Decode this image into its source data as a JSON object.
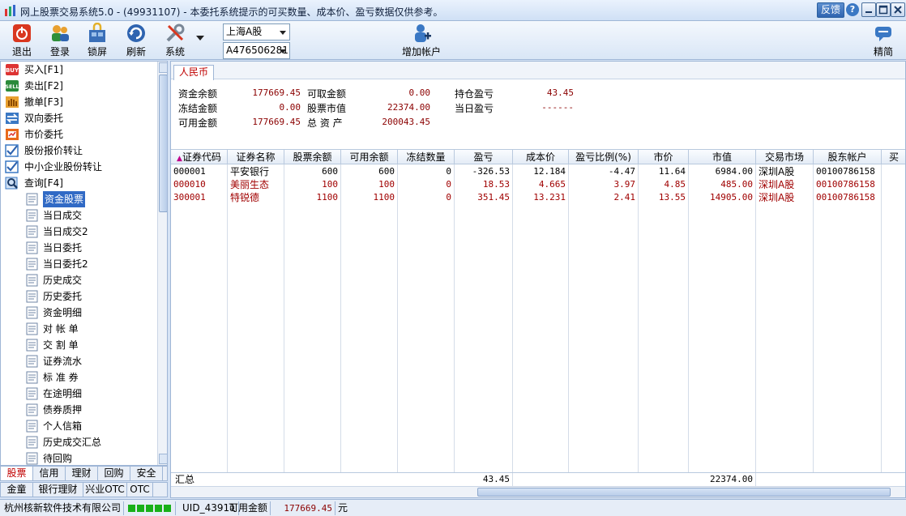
{
  "window": {
    "title": "网上股票交易系统5.0 - (49931107) - 本委托系统提示的可买数量、成本价、盈亏数据仅供参考。",
    "feedback": "反馈",
    "help": "?"
  },
  "toolbar": {
    "exit": "退出",
    "login": "登录",
    "lock": "锁屏",
    "refresh": "刷新",
    "system": "系统",
    "market_select": "上海A股",
    "account_select": "A476506281",
    "add_account": "增加帐户",
    "simple": "精简"
  },
  "tree": [
    {
      "label": "买入[F1]",
      "icon": "buy-icon"
    },
    {
      "label": "卖出[F2]",
      "icon": "sell-icon"
    },
    {
      "label": "撤单[F3]",
      "icon": "cancel-hand-icon"
    },
    {
      "label": "双向委托",
      "icon": "bidirectional-icon"
    },
    {
      "label": "市价委托",
      "icon": "market-order-icon"
    },
    {
      "label": "股份报价转让",
      "icon": "checkbox-icon"
    },
    {
      "label": "中小企业股份转让",
      "icon": "checkbox-icon"
    },
    {
      "label": "查询[F4]",
      "icon": "query-icon"
    },
    {
      "label": "资金股票",
      "icon": "document-icon",
      "selected": true
    },
    {
      "label": "当日成交",
      "icon": "document-icon"
    },
    {
      "label": "当日成交2",
      "icon": "document-icon"
    },
    {
      "label": "当日委托",
      "icon": "document-icon"
    },
    {
      "label": "当日委托2",
      "icon": "document-icon"
    },
    {
      "label": "历史成交",
      "icon": "document-icon"
    },
    {
      "label": "历史委托",
      "icon": "document-icon"
    },
    {
      "label": "资金明细",
      "icon": "document-icon"
    },
    {
      "label": "对 帐 单",
      "icon": "document-icon"
    },
    {
      "label": "交 割 单",
      "icon": "document-icon"
    },
    {
      "label": "证券流水",
      "icon": "document-icon"
    },
    {
      "label": "标 准 券",
      "icon": "document-icon"
    },
    {
      "label": "在途明细",
      "icon": "document-icon"
    },
    {
      "label": "债券质押",
      "icon": "document-icon"
    },
    {
      "label": "个人信箱",
      "icon": "document-icon"
    },
    {
      "label": "历史成交汇总",
      "icon": "document-icon"
    },
    {
      "label": "待回购",
      "icon": "document-icon"
    }
  ],
  "bottom_tabs_row1": [
    "股票",
    "信用",
    "理财",
    "回购",
    "安全"
  ],
  "bottom_tabs_row2": [
    "金童",
    "银行理财",
    "兴业OTC",
    "OTC"
  ],
  "currency_tab": "人民币",
  "summary": {
    "fund_balance_label": "资金余额",
    "fund_balance": "177669.45",
    "withdrawable_label": "可取金额",
    "withdrawable": "0.00",
    "holding_pl_label": "持仓盈亏",
    "holding_pl": "43.45",
    "frozen_label": "冻结金额",
    "frozen": "0.00",
    "stock_value_label": "股票市值",
    "stock_value": "22374.00",
    "today_pl_label": "当日盈亏",
    "today_pl": "------",
    "available_label": "可用金额",
    "available": "177669.45",
    "total_assets_label": "总 资 产",
    "total_assets": "200043.45"
  },
  "table": {
    "sort_mark": "▲",
    "headers": [
      "证券代码",
      "证券名称",
      "股票余额",
      "可用余额",
      "冻结数量",
      "盈亏",
      "成本价",
      "盈亏比例(%)",
      "市价",
      "市值",
      "交易市场",
      "股东帐户",
      "买"
    ],
    "rows": [
      {
        "code": "000001",
        "name": "平安银行",
        "balance": "600",
        "available": "600",
        "frozen": "0",
        "pl": "-326.53",
        "cost": "12.184",
        "pl_ratio": "-4.47",
        "price": "11.64",
        "value": "6984.00",
        "market": "深圳A股",
        "account": "00100786158",
        "color": "#000000"
      },
      {
        "code": "000010",
        "name": "美丽生态",
        "balance": "100",
        "available": "100",
        "frozen": "0",
        "pl": "18.53",
        "cost": "4.665",
        "pl_ratio": "3.97",
        "price": "4.85",
        "value": "485.00",
        "market": "深圳A股",
        "account": "00100786158",
        "color": "#a00000"
      },
      {
        "code": "300001",
        "name": "特锐德",
        "balance": "1100",
        "available": "1100",
        "frozen": "0",
        "pl": "351.45",
        "cost": "13.231",
        "pl_ratio": "2.41",
        "price": "13.55",
        "value": "14905.00",
        "market": "深圳A股",
        "account": "00100786158",
        "color": "#a00000"
      }
    ],
    "total_label": "汇总",
    "total_pl": "43.45",
    "total_value": "22374.00"
  },
  "status": {
    "company": "杭州核新软件技术有限公司",
    "uid": "UID_43911",
    "available_label": "可用金额",
    "available_value": "177669.45",
    "unit": "元"
  },
  "colors": {
    "accent": "#316ac5",
    "profit": "#a00000",
    "title_bg": "#d6e3f5"
  }
}
